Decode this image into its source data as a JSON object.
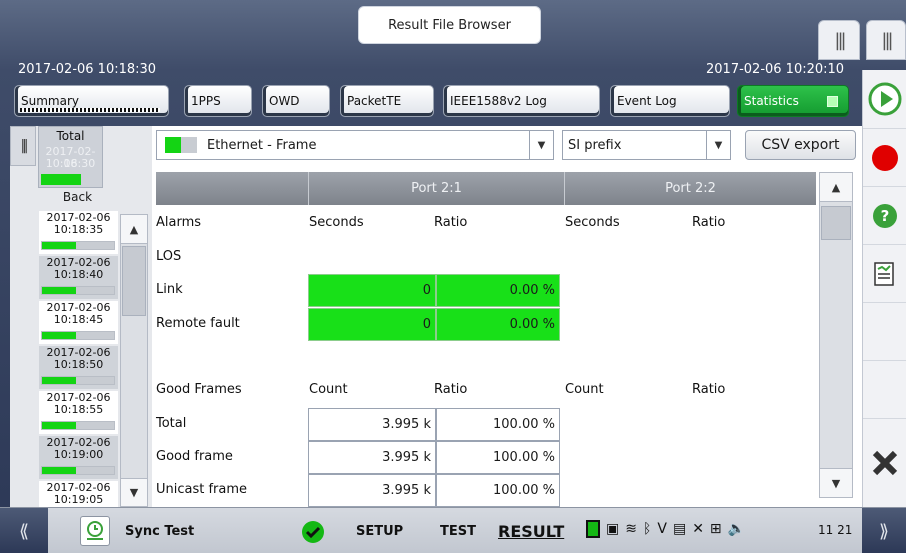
{
  "header": {
    "title": "Result File Browser",
    "start_time": "2017-02-06 10:18:30",
    "end_time": "2017-02-06 10:20:10"
  },
  "tabs": [
    {
      "label": "Summary"
    },
    {
      "label": "1PPS"
    },
    {
      "label": "OWD"
    },
    {
      "label": "PacketTE"
    },
    {
      "label": "IEEE1588v2 Log"
    },
    {
      "label": "Event Log"
    },
    {
      "label": "Statistics"
    }
  ],
  "history": {
    "total_label": "Total",
    "total_date": "2017-02-06",
    "total_time": "10:18:30",
    "back_label": "Back",
    "items": [
      {
        "date": "2017-02-06",
        "time": "10:18:35"
      },
      {
        "date": "2017-02-06",
        "time": "10:18:40"
      },
      {
        "date": "2017-02-06",
        "time": "10:18:45"
      },
      {
        "date": "2017-02-06",
        "time": "10:18:50"
      },
      {
        "date": "2017-02-06",
        "time": "10:18:55"
      },
      {
        "date": "2017-02-06",
        "time": "10:19:00"
      },
      {
        "date": "2017-02-06",
        "time": "10:19:05"
      }
    ]
  },
  "filters": {
    "view": "Ethernet - Frame",
    "prefix": "SI prefix",
    "csv_label": "CSV export"
  },
  "table": {
    "ports": [
      "Port 2:1",
      "Port 2:2"
    ],
    "alarms": {
      "label": "Alarms",
      "col_a": "Seconds",
      "col_b": "Ratio",
      "rows": [
        {
          "label": "LOS",
          "p1_a": "",
          "p1_b": ""
        },
        {
          "label": "Link",
          "p1_a": "0",
          "p1_b": "0.00 %"
        },
        {
          "label": "Remote fault",
          "p1_a": "0",
          "p1_b": "0.00 %"
        }
      ]
    },
    "frames": {
      "label": "Good Frames",
      "col_a": "Count",
      "col_b": "Ratio",
      "rows": [
        {
          "label": "Total",
          "p1_a": "3.995 k",
          "p1_b": "100.00 %"
        },
        {
          "label": "Good frame",
          "p1_a": "3.995 k",
          "p1_b": "100.00 %"
        },
        {
          "label": "Unicast frame",
          "p1_a": "3.995 k",
          "p1_b": "100.00 %"
        }
      ]
    }
  },
  "status_bar": {
    "app_name": "Sync Test",
    "setup": "SETUP",
    "test": "TEST",
    "result": "RESULT",
    "clock": "11 21"
  },
  "colors": {
    "accent_green": "#14d414",
    "record_red": "#e00000",
    "help_green": "#3aa13a"
  }
}
